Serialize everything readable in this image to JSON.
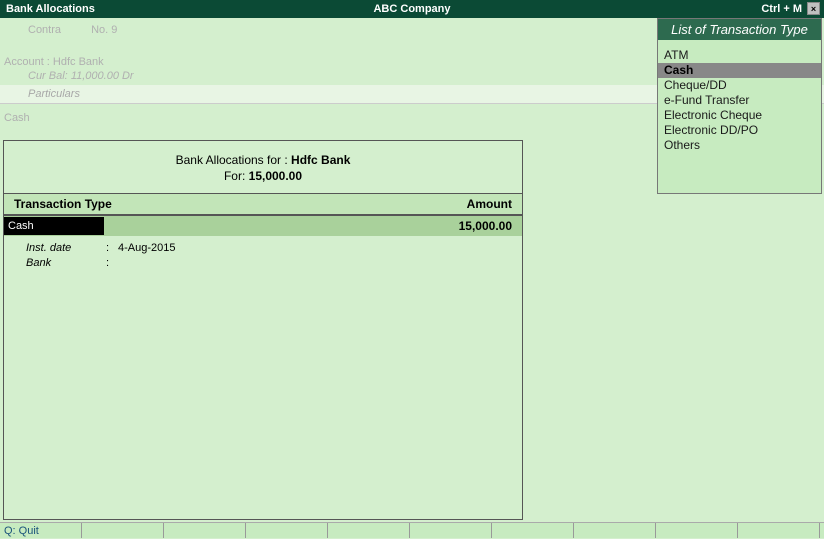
{
  "topbar": {
    "left": "Bank Allocations",
    "center": "ABC Company",
    "right_label": "Ctrl + M",
    "close_glyph": "×"
  },
  "voucher_bg": {
    "contra_label": "Contra",
    "no_label": "No.",
    "no_value": "9",
    "account_label": "Account :",
    "account_value": "Hdfc Bank",
    "curbal_label": "Cur Bal:",
    "curbal_value": "11,000.00 Dr",
    "particulars_label": "Particulars",
    "cash_label": "Cash"
  },
  "modal": {
    "title_prefix": "Bank Allocations for : ",
    "title_bank": "Hdfc Bank",
    "for_label": "For: ",
    "for_amount": "15,000.00",
    "col_type": "Transaction Type",
    "col_amount": "Amount",
    "row_type": "Cash",
    "row_amount": "15,000.00",
    "inst_date_label": "Inst. date",
    "inst_date_value": "4-Aug-2015",
    "bank_label": "Bank",
    "bank_value": ""
  },
  "sidebar": {
    "title": "List of Transaction Type",
    "items": [
      {
        "label": "ATM"
      },
      {
        "label": "Cash"
      },
      {
        "label": "Cheque/DD"
      },
      {
        "label": "e-Fund Transfer"
      },
      {
        "label": "Electronic Cheque"
      },
      {
        "label": "Electronic DD/PO"
      },
      {
        "label": "Others"
      }
    ],
    "selected_index": 1
  },
  "bottombar": {
    "quit_key": "Q:",
    "quit_label": " Quit"
  }
}
